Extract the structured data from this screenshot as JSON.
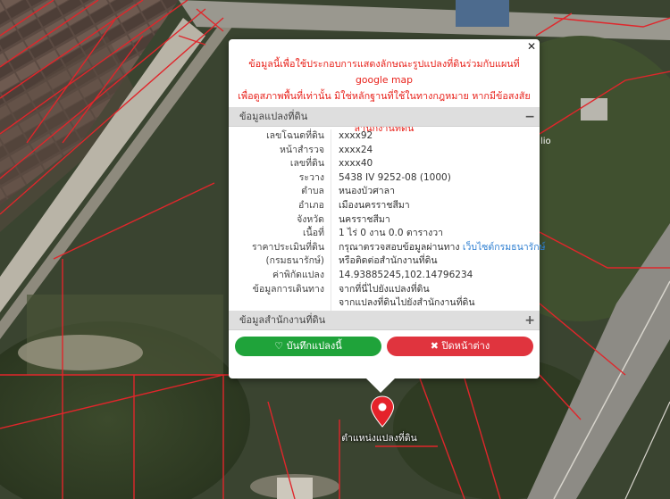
{
  "popup": {
    "close_icon": "close-icon",
    "disclaimer_line1": "ข้อมูลนี้เพื่อใช้ประกอบการแสดงลักษณะรูปแปลงที่ดินร่วมกับแผนที่ google map",
    "disclaimer_line2": "เพื่อดูสภาพพื้นที่เท่านั้น มิใช่หลักฐานที่ใช้ในทางกฎหมาย หากมีข้อสงสัย กรุณาติดต่อ",
    "disclaimer_line3": "สำนักงานที่ดิน",
    "section1_title": "ข้อมูลแปลงที่ดิน",
    "section1_toggle": "−",
    "section2_title": "ข้อมูลสำนักงานที่ดิน",
    "section2_toggle": "+",
    "rows": [
      {
        "key": "เลขโฉนดที่ดิน",
        "value": "xxxx92"
      },
      {
        "key": "หน้าสำรวจ",
        "value": "xxxx24"
      },
      {
        "key": "เลขที่ดิน",
        "value": "xxxx40"
      },
      {
        "key": "ระวาง",
        "value": "5438 IV 9252-08 (1000)"
      },
      {
        "key": "ตำบล",
        "value": "หนองบัวศาลา"
      },
      {
        "key": "อำเภอ",
        "value": "เมืองนครราชสีมา"
      },
      {
        "key": "จังหวัด",
        "value": "นครราชสีมา"
      },
      {
        "key": "เนื้อที่",
        "value": "1 ไร่ 0 งาน 0.0 ตารางวา"
      },
      {
        "key": "ราคาประเมินที่ดิน",
        "value": "กรุณาตรวจสอบข้อมูลผ่านทาง",
        "link": "เว็บไซต์กรมธนารักษ์"
      },
      {
        "key": "(กรมธนารักษ์)",
        "value": "หรือติดต่อสำนักงานที่ดิน"
      },
      {
        "key": "ค่าพิกัดแปลง",
        "link": "14.93885245,102.14796234"
      },
      {
        "key": "ข้อมูลการเดินทาง",
        "link": "จากที่นี่ไปยังแปลงที่ดิน"
      },
      {
        "key": "",
        "link": "จากแปลงที่ดินไปยังสำนักงานที่ดิน"
      }
    ],
    "save_button": "บันทึกแปลงนี้",
    "close_button": "ปิดหน้าต่าง"
  },
  "map": {
    "marker_label": "ตำแหน่งแปลงที่ดิน",
    "marker_icon": "map-pin-icon",
    "partial_label": "lio"
  },
  "colors": {
    "disclaimer": "#e8221b",
    "link": "#2d7ed1",
    "save": "#1fa33a",
    "close": "#e0343e",
    "parcel_line": "#e0262b"
  }
}
